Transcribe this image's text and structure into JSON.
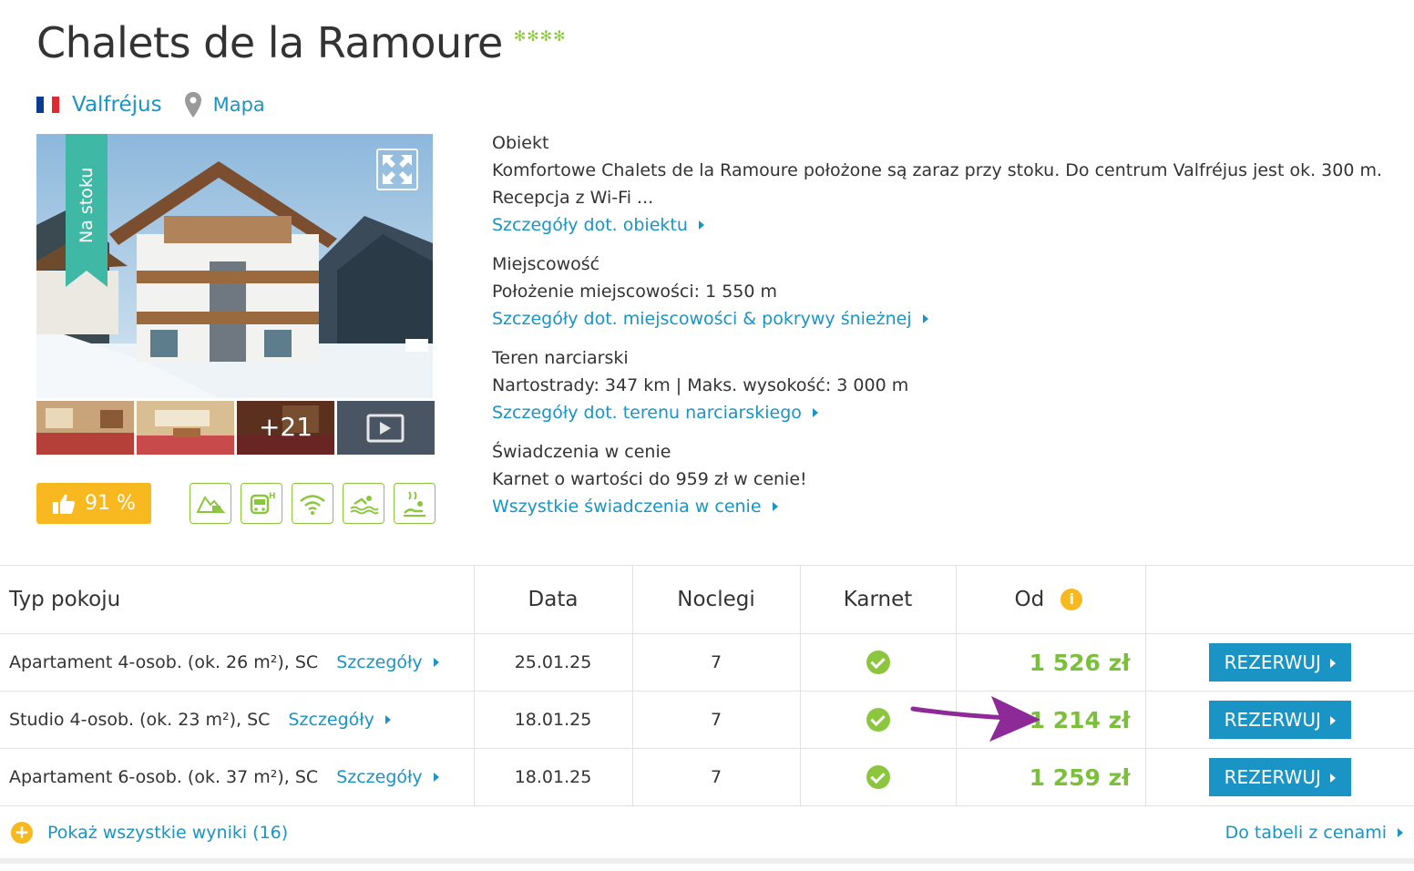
{
  "hotel": {
    "name": "Chalets de la Ramoure",
    "stars": "✻✻✻✻",
    "location": "Valfréjus",
    "map_label": "Mapa"
  },
  "photo": {
    "ribbon": "Na stoku",
    "more_count": "+21",
    "icons": [
      "expand-icon",
      "video-play-icon"
    ]
  },
  "rating": "91 %",
  "amenities": [
    "ski-slope-house-icon",
    "shuttle-bus-icon",
    "wifi-icon",
    "swimming-pool-icon",
    "spa-icon"
  ],
  "info": {
    "object_heading": "Obiekt",
    "object_text": "Komfortowe Chalets de la Ramoure położone są zaraz przy stoku. Do centrum Valfréjus jest ok. 300 m. Recepcja z Wi-Fi ...",
    "object_link": "Szczegóły dot. obiektu",
    "town_heading": "Miejscowość",
    "town_text": "Położenie miejscowości: 1 550 m",
    "town_link": "Szczegóły dot. miejscowości & pokrywy śnieżnej",
    "ski_heading": "Teren narciarski",
    "ski_text": "Nartostrady: 347 km | Maks. wysokość: 3 000 m",
    "ski_link": "Szczegóły dot. terenu narciarskiego",
    "included_heading": "Świadczenia w cenie",
    "included_text": "Karnet o wartości do 959 zł w cenie!",
    "included_link": "Wszystkie świadczenia w cenie"
  },
  "table": {
    "headers": {
      "type": "Typ pokoju",
      "date": "Data",
      "nights": "Noclegi",
      "pass": "Karnet",
      "price": "Od"
    },
    "rows": [
      {
        "type": "Apartament 4-osob. (ok. 26 m²), SC",
        "details": "Szczegóły",
        "date": "25.01.25",
        "nights": "7",
        "price": "1 526 zł",
        "button": "REZERWUJ"
      },
      {
        "type": "Studio 4-osob. (ok. 23 m²), SC",
        "details": "Szczegóły",
        "date": "18.01.25",
        "nights": "7",
        "price": "1 214 zł",
        "button": "REZERWUJ"
      },
      {
        "type": "Apartament 6-osob. (ok. 37 m²), SC",
        "details": "Szczegóły",
        "date": "18.01.25",
        "nights": "7",
        "price": "1 259 zł",
        "button": "REZERWUJ"
      }
    ]
  },
  "footer": {
    "show_all": "Pokaż wszystkie wyniki (16)",
    "to_table": "Do tabeli z cenami"
  },
  "colors": {
    "link": "#1a94c4",
    "price_green": "#7cbf3c",
    "rating_yellow": "#f8b820",
    "annotation_arrow": "#8e2a98"
  }
}
